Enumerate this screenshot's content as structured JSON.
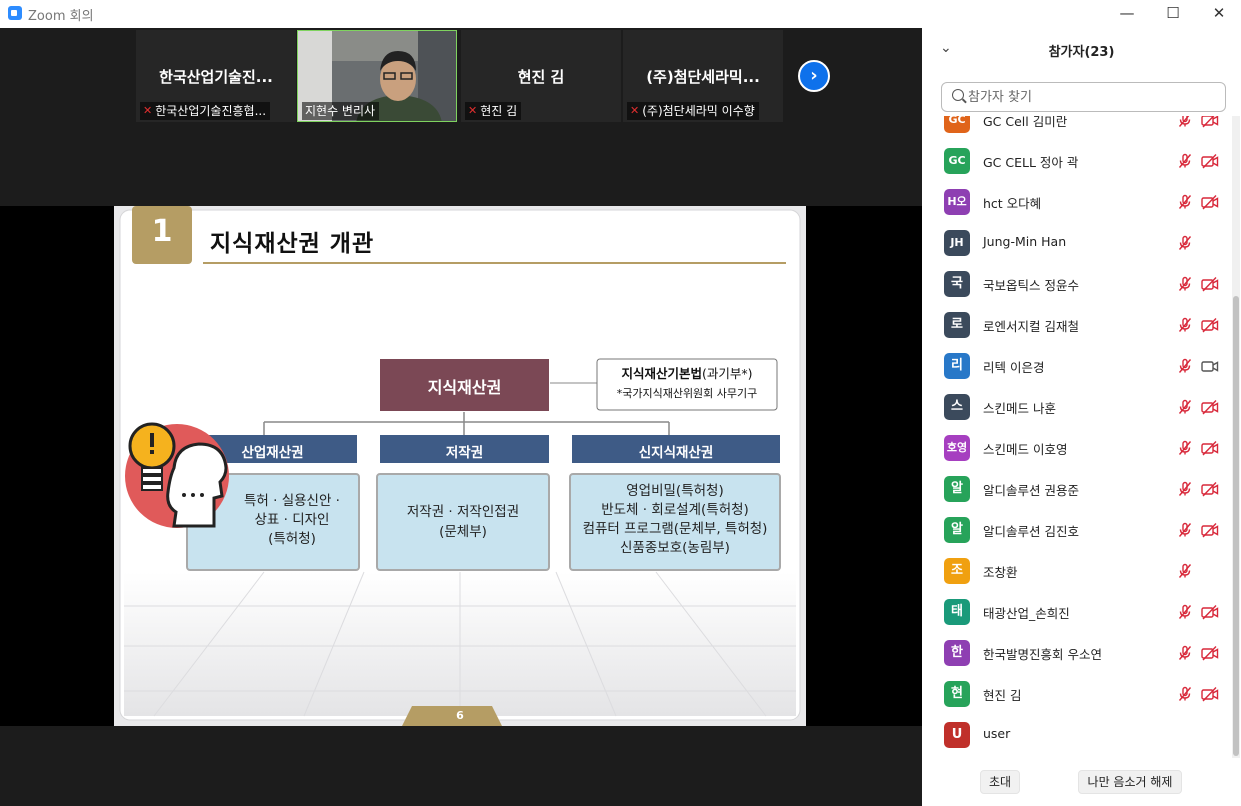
{
  "window": {
    "title": "Zoom 회의",
    "minimize": "—",
    "maximize": "☐",
    "close": "✕"
  },
  "tiles": [
    {
      "name": "한국산업기술진...",
      "label": "한국산업기술진흥협..."
    },
    {
      "name": "",
      "label": "지현수 변리사"
    },
    {
      "name": "현진 김",
      "label": "현진 김"
    },
    {
      "name": "(주)첨단세라믹...",
      "label": "(주)첨단세라믹 이수향"
    }
  ],
  "next_button": "›",
  "slide": {
    "number": "1",
    "title": "지식재산권 개관",
    "root": "지식재산권",
    "law_title": "지식재산기본법",
    "law_ministry": "(과기부*)",
    "law_note": "*국가지식재산위원회 사무기구",
    "categories": [
      {
        "header": "산업재산권",
        "lines": [
          "특허 · 실용신안 ·",
          "상표 · 디자인",
          "(특허청)"
        ]
      },
      {
        "header": "저작권",
        "lines": [
          "저작권 · 저작인접권",
          "(문체부)"
        ]
      },
      {
        "header": "신지식재산권",
        "lines": [
          "영업비밀(특허청)",
          "반도체 · 회로설계(특허청)",
          "컴퓨터 프로그램(문체부, 특허청)",
          "신품종보호(농림부)"
        ]
      }
    ],
    "page": "6"
  },
  "panel": {
    "title": "참가자(23)",
    "search_placeholder": "참가자 찾기",
    "participants": [
      {
        "initials": "GC",
        "name": "GC Cell 김미란",
        "color": "#e0641a",
        "cam": "off"
      },
      {
        "initials": "GC",
        "name": "GC CELL 정아 곽",
        "color": "#27a35a",
        "cam": "off"
      },
      {
        "initials": "H오",
        "name": "hct 오다혜",
        "color": "#8e3fb2",
        "cam": "off"
      },
      {
        "initials": "JH",
        "name": "Jung-Min Han",
        "color": "#3b4a5c",
        "cam": "none"
      },
      {
        "initials": "국",
        "name": "국보옵틱스 정윤수",
        "color": "#3b4a5c",
        "cam": "off"
      },
      {
        "initials": "로",
        "name": "로엔서지컬 김재철",
        "color": "#3b4a5c",
        "cam": "off"
      },
      {
        "initials": "리",
        "name": "리텍 이은경",
        "color": "#2878c8",
        "cam": "on"
      },
      {
        "initials": "스",
        "name": "스킨메드 나훈",
        "color": "#3b4a5c",
        "cam": "off"
      },
      {
        "initials": "호영",
        "name": "스킨메드 이호영",
        "color": "#a63fc0",
        "cam": "off"
      },
      {
        "initials": "알",
        "name": "알디솔루션 권용준",
        "color": "#27a35a",
        "cam": "off"
      },
      {
        "initials": "알",
        "name": "알디솔루션 김진호",
        "color": "#27a35a",
        "cam": "off"
      },
      {
        "initials": "조",
        "name": "조창환",
        "color": "#f0a010",
        "cam": "none"
      },
      {
        "initials": "태",
        "name": "태광산업_손희진",
        "color": "#1a9a7a",
        "cam": "off"
      },
      {
        "initials": "한",
        "name": "한국발명진흥회 우소연",
        "color": "#8e3fb2",
        "cam": "off"
      },
      {
        "initials": "현",
        "name": "현진 김",
        "color": "#27a35a",
        "cam": "off"
      },
      {
        "initials": "U",
        "name": "user",
        "color": "#c0302a",
        "cam": "nomic"
      }
    ],
    "invite": "초대",
    "unmute_me": "나만 음소거 해제"
  },
  "colors": {
    "accent": "#0e71eb",
    "slide_gold": "#b59d64",
    "slide_root": "#7b4855",
    "slide_header": "#3e5b86",
    "slide_box": "#c8e3ef"
  }
}
